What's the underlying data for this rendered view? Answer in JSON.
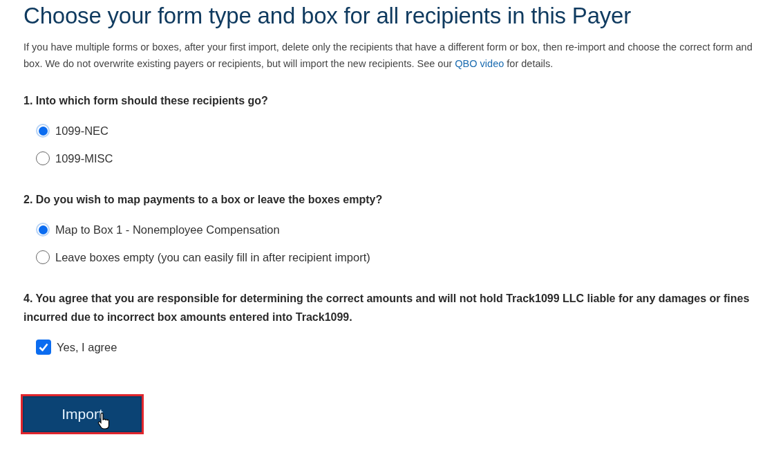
{
  "title": "Choose your form type and box for all recipients in this Payer",
  "intro": {
    "before": "If you have multiple forms or boxes, after your first import, delete only the recipients that have a different form or box, then re-import and choose the correct form and box. We do not overwrite existing payers or recipients, but will import the new recipients. See our",
    "link": "QBO video",
    "after": "for details."
  },
  "questions": [
    {
      "kind": "radio",
      "label": "1. Into which form should these recipients go?",
      "options": [
        {
          "label": "1099-NEC",
          "selected": true
        },
        {
          "label": "1099-MISC",
          "selected": false
        }
      ]
    },
    {
      "kind": "radio",
      "label": "2. Do you wish to map payments to a box or leave the boxes empty?",
      "options": [
        {
          "label": "Map to Box 1 - Nonemployee Compensation",
          "selected": true
        },
        {
          "label": "Leave boxes empty (you can easily fill in after recipient import)",
          "selected": false
        }
      ]
    },
    {
      "kind": "checkbox",
      "label": "4. You agree that you are responsible for determining the correct amounts and will not hold Track1099 LLC liable for any damages or fines incurred due to incorrect box amounts entered into Track1099.",
      "options": [
        {
          "label": "Yes, I agree",
          "checked": true
        }
      ]
    }
  ],
  "import_button": {
    "label": "Import",
    "highlighted": true
  }
}
